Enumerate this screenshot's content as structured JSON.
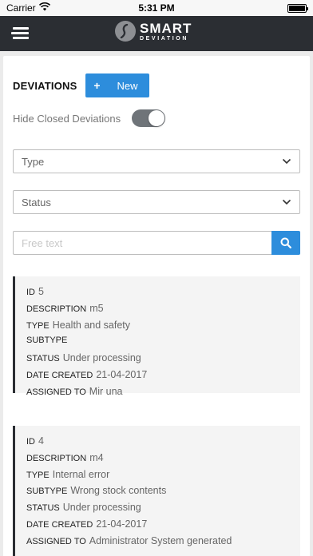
{
  "status_bar": {
    "carrier": "Carrier",
    "time": "5:31 PM",
    "battery_level": 1.0
  },
  "nav": {
    "menu_icon": "hamburger-menu-icon",
    "logo_title": "SMART",
    "logo_subtitle": "DEVIATION"
  },
  "header": {
    "title": "DEVIATIONS",
    "new_button": {
      "icon": "+",
      "label": "New",
      "color": "#2d8ddc"
    }
  },
  "filters": {
    "hide_closed_label": "Hide Closed Deviations",
    "hide_closed_on": true,
    "type_select": "Type",
    "status_select": "Status",
    "search_placeholder": "Free text",
    "search_value": ""
  },
  "deviations": [
    {
      "id_label": "ID",
      "id": "5",
      "description_label": "DESCRIPTION",
      "description": "m5",
      "type_label": "TYPE",
      "type": "Health and safety",
      "subtype_label": "SUBTYPE",
      "subtype": "",
      "status_label": "STATUS",
      "status": "Under processing",
      "date_label": "DATE CREATED",
      "date": "21-04-2017",
      "assigned_label": "ASSIGNED TO",
      "assigned": "Mir una"
    },
    {
      "id_label": "ID",
      "id": "4",
      "description_label": "DESCRIPTION",
      "description": "m4",
      "type_label": "TYPE",
      "type": "Internal error",
      "subtype_label": "SUBTYPE",
      "subtype": "Wrong stock contents",
      "status_label": "STATUS",
      "status": "Under processing",
      "date_label": "DATE CREATED",
      "date": "21-04-2017",
      "assigned_label": "ASSIGNED TO",
      "assigned": "Administrator System generated"
    }
  ],
  "colors": {
    "nav_bg": "#2b2e33",
    "accent": "#2d8ddc",
    "toggle_on": "#6f7479",
    "card_bg": "#f4f4f4"
  }
}
